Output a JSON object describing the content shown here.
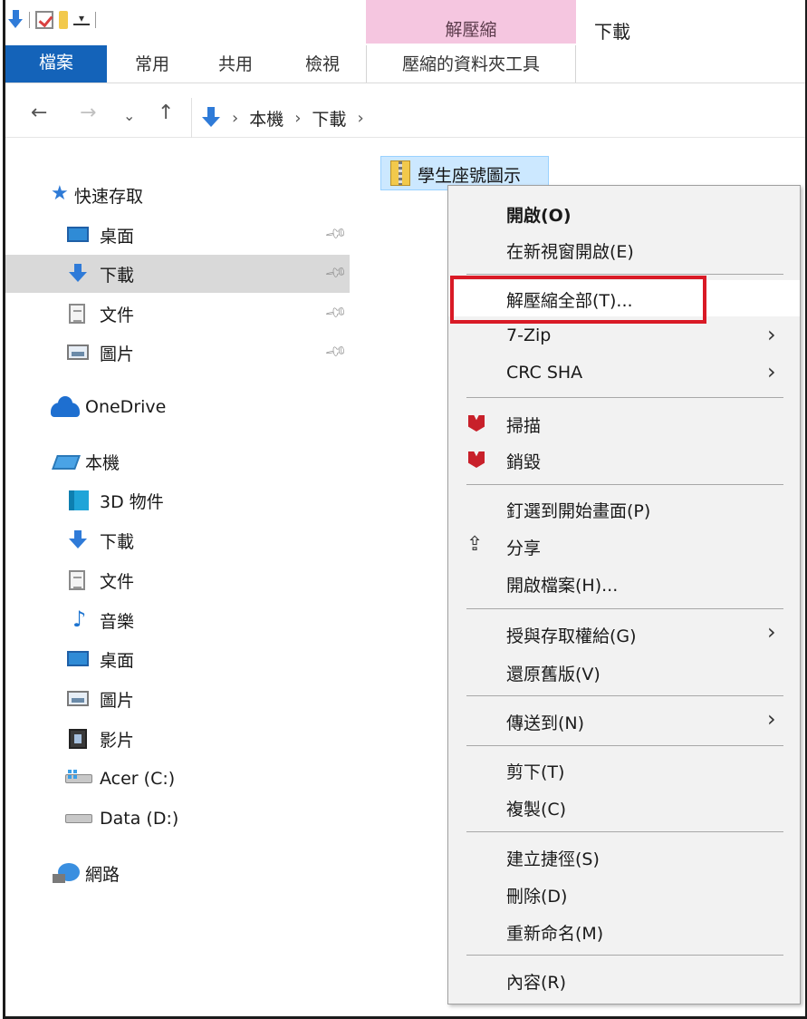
{
  "window": {
    "title": "下載"
  },
  "ribbon": {
    "context_tab_header": "解壓縮",
    "tabs": [
      "檔案",
      "常用",
      "共用",
      "檢視",
      "壓縮的資料夾工具"
    ]
  },
  "address": {
    "crumbs": [
      "本機",
      "下載"
    ]
  },
  "sidebar": {
    "items": [
      {
        "label": "快速存取",
        "icon": "star-icon"
      },
      {
        "label": "桌面",
        "icon": "desktop-icon"
      },
      {
        "label": "下載",
        "icon": "download-icon"
      },
      {
        "label": "文件",
        "icon": "documents-icon"
      },
      {
        "label": "圖片",
        "icon": "pictures-icon"
      },
      {
        "label": "OneDrive",
        "icon": "onedrive-icon"
      },
      {
        "label": "本機",
        "icon": "this-pc-icon"
      },
      {
        "label": "3D 物件",
        "icon": "3d-objects-icon"
      },
      {
        "label": "下載",
        "icon": "download-icon"
      },
      {
        "label": "文件",
        "icon": "documents-icon"
      },
      {
        "label": "音樂",
        "icon": "music-icon"
      },
      {
        "label": "桌面",
        "icon": "desktop-icon"
      },
      {
        "label": "圖片",
        "icon": "pictures-icon"
      },
      {
        "label": "影片",
        "icon": "videos-icon"
      },
      {
        "label": "Acer (C:)",
        "icon": "drive-c-icon"
      },
      {
        "label": "Data (D:)",
        "icon": "drive-d-icon"
      },
      {
        "label": "網路",
        "icon": "network-icon"
      }
    ]
  },
  "file": {
    "name": "學生座號圖示",
    "icon": "zip-folder-icon"
  },
  "context_menu": {
    "items": [
      "開啟(O)",
      "在新視窗開啟(E)",
      "解壓縮全部(T)...",
      "7-Zip",
      "CRC SHA",
      "掃描",
      "銷毀",
      "釘選到開始畫面(P)",
      "分享",
      "開啟檔案(H)...",
      "授與存取權給(G)",
      "還原舊版(V)",
      "傳送到(N)",
      "剪下(T)",
      "複製(C)",
      "建立捷徑(S)",
      "刪除(D)",
      "重新命名(M)",
      "內容(R)"
    ]
  },
  "colors": {
    "file_tab": "#1463b9",
    "context_tab": "#f5c6e0",
    "highlight_box": "#d91a26",
    "selection": "#cce8ff"
  }
}
